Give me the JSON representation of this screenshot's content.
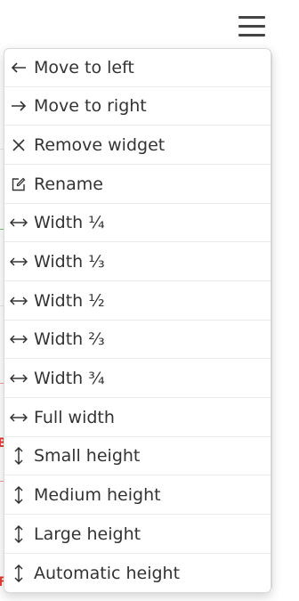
{
  "header": {
    "menu_icon": "hamburger-icon"
  },
  "background": {
    "fragments": [
      "B",
      "F"
    ]
  },
  "menu": {
    "items": [
      {
        "label": "Move to left",
        "icon": "arrow-left-icon"
      },
      {
        "label": "Move to right",
        "icon": "arrow-right-icon"
      },
      {
        "label": "Remove widget",
        "icon": "close-icon"
      },
      {
        "label": "Rename",
        "icon": "edit-icon"
      },
      {
        "label": "Width ¼",
        "icon": "resize-horizontal-icon"
      },
      {
        "label": "Width ⅓",
        "icon": "resize-horizontal-icon"
      },
      {
        "label": "Width ½",
        "icon": "resize-horizontal-icon"
      },
      {
        "label": "Width ⅔",
        "icon": "resize-horizontal-icon"
      },
      {
        "label": "Width ¾",
        "icon": "resize-horizontal-icon"
      },
      {
        "label": "Full width",
        "icon": "resize-horizontal-icon"
      },
      {
        "label": "Small height",
        "icon": "resize-vertical-icon"
      },
      {
        "label": "Medium height",
        "icon": "resize-vertical-icon"
      },
      {
        "label": "Large height",
        "icon": "resize-vertical-icon"
      },
      {
        "label": "Automatic height",
        "icon": "resize-vertical-icon"
      }
    ]
  },
  "colors": {
    "text": "#333333",
    "accent_red": "#e53935",
    "border": "#d9d9d9"
  }
}
